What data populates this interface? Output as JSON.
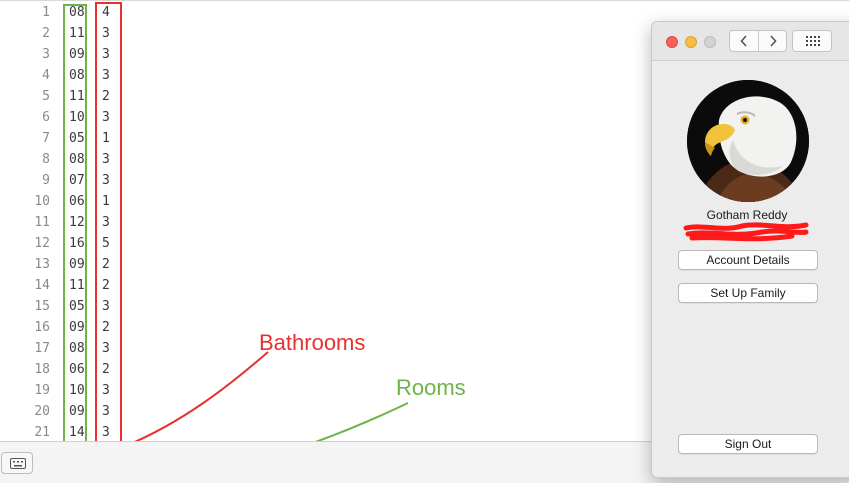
{
  "editor": {
    "lines": [
      {
        "n": "1",
        "rooms": "08",
        "baths": "4"
      },
      {
        "n": "2",
        "rooms": "11",
        "baths": "3"
      },
      {
        "n": "3",
        "rooms": "09",
        "baths": "3"
      },
      {
        "n": "4",
        "rooms": "08",
        "baths": "3"
      },
      {
        "n": "5",
        "rooms": "11",
        "baths": "2"
      },
      {
        "n": "6",
        "rooms": "10",
        "baths": "3"
      },
      {
        "n": "7",
        "rooms": "05",
        "baths": "1"
      },
      {
        "n": "8",
        "rooms": "08",
        "baths": "3"
      },
      {
        "n": "9",
        "rooms": "07",
        "baths": "3"
      },
      {
        "n": "10",
        "rooms": "06",
        "baths": "1"
      },
      {
        "n": "11",
        "rooms": "12",
        "baths": "3"
      },
      {
        "n": "12",
        "rooms": "16",
        "baths": "5"
      },
      {
        "n": "13",
        "rooms": "09",
        "baths": "2"
      },
      {
        "n": "14",
        "rooms": "11",
        "baths": "2"
      },
      {
        "n": "15",
        "rooms": "05",
        "baths": "3"
      },
      {
        "n": "16",
        "rooms": "09",
        "baths": "2"
      },
      {
        "n": "17",
        "rooms": "08",
        "baths": "3"
      },
      {
        "n": "18",
        "rooms": "06",
        "baths": "2"
      },
      {
        "n": "19",
        "rooms": "10",
        "baths": "3"
      },
      {
        "n": "20",
        "rooms": "09",
        "baths": "3"
      },
      {
        "n": "21",
        "rooms": "14",
        "baths": "3"
      }
    ]
  },
  "annotations": {
    "bathrooms_label": "Bathrooms",
    "rooms_label": "Rooms",
    "bathrooms_color": "#e8312c",
    "rooms_color": "#6db34a"
  },
  "statusbar": {
    "keyboard_icon": "keyboard-icon"
  },
  "account_window": {
    "user_name": "Gotham Reddy",
    "buttons": {
      "account_details": "Account Details",
      "setup_family": "Set Up Family",
      "sign_out": "Sign Out"
    },
    "icons": [
      "back-icon",
      "forward-icon",
      "grid-icon",
      "eagle-avatar"
    ]
  }
}
